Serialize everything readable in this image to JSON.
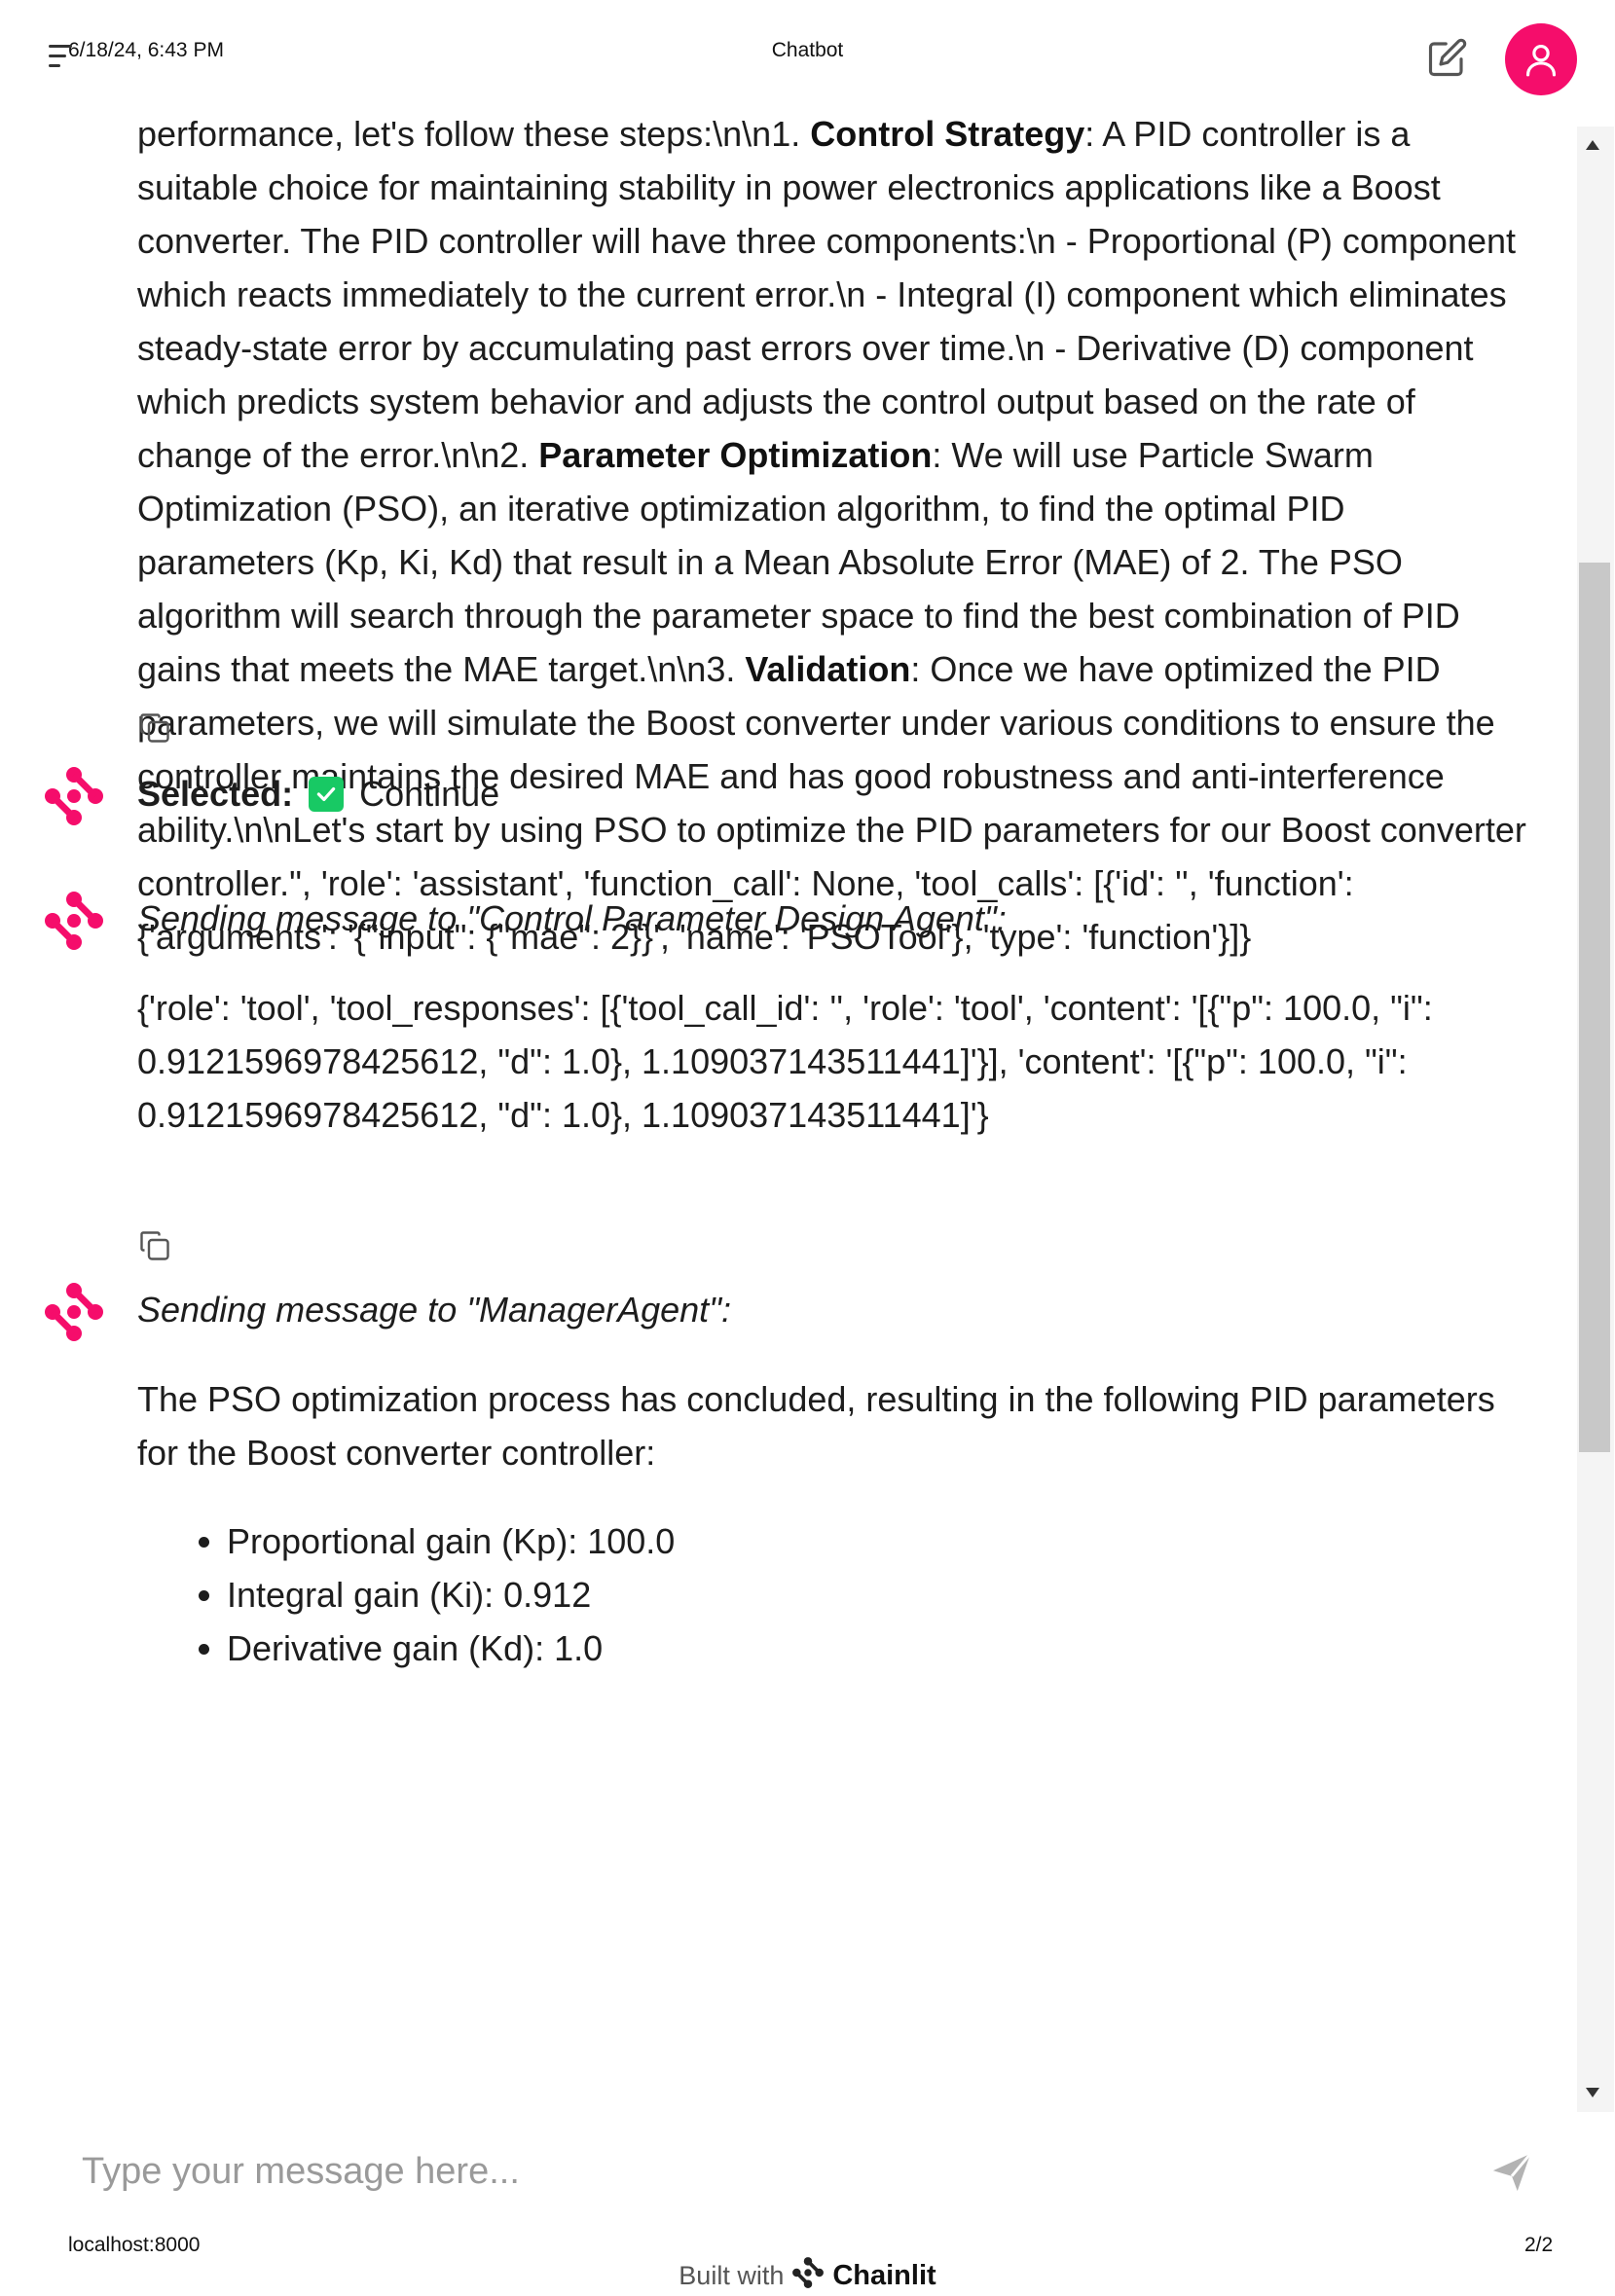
{
  "print_header": {
    "date": "6/18/24, 6:43 PM",
    "title": "Chatbot"
  },
  "print_footer": {
    "url": "localhost:8000",
    "page": "2/2"
  },
  "brand": {
    "accent": "#f50d6b",
    "check_color": "#18c964"
  },
  "icons": {
    "menu": "menu-icon",
    "edit": "edit-icon",
    "avatar": "user-avatar-icon",
    "copy": "copy-icon",
    "logo": "chainlit-logo-icon",
    "send": "send-icon"
  },
  "messages": {
    "m1": {
      "s1": "performance, let's follow these steps:\\n\\n1. ",
      "b1": "Control Strategy",
      "s2": ": A PID controller is a suitable choice for maintaining stability in power electronics applications like a Boost converter. The PID controller will have three components:\\n   - Proportional (P) component which reacts immediately to the current error.\\n   - Integral (I) component which eliminates steady-state error by accumulating past errors over time.\\n   - Derivative (D) component which predicts system behavior and adjusts the control output based on the rate of change of the error.\\n\\n2. ",
      "b2": "Parameter Optimization",
      "s3": ": We will use Particle Swarm Optimization (PSO), an iterative optimization algorithm, to find the optimal PID parameters (Kp, Ki, Kd) that result in a Mean Absolute Error (MAE) of 2. The PSO algorithm will search through the parameter space to find the best combination of PID gains that meets the MAE target.\\n\\n3. ",
      "b3": "Validation",
      "s4": ": Once we have optimized the PID parameters, we will simulate the Boost converter under various conditions to ensure the controller maintains the desired MAE and has good robustness and anti-interference ability.\\n\\nLet's start by using PSO to optimize the PID parameters for our Boost converter controller.\", 'role': 'assistant', 'function_call': None, 'tool_calls': [{'id': '', 'function': {'arguments': '{\"input\": {\"mae\": 2}}', 'name': 'PSOTool'}, 'type': 'function'}]}"
    },
    "m2": {
      "selected_label": "Selected:",
      "choice": "Continue"
    },
    "m3": {
      "heading": "Sending message to \"Control Parameter Design Agent\":",
      "body": "{'role': 'tool', 'tool_responses': [{'tool_call_id': '', 'role': 'tool', 'content': '[{\"p\": 100.0, \"i\": 0.9121596978425612, \"d\": 1.0}, 1.109037143511441]'}], 'content': '[{\"p\": 100.0, \"i\": 0.9121596978425612, \"d\": 1.0}, 1.109037143511441]'}"
    },
    "m4": {
      "heading": "Sending message to \"ManagerAgent\":",
      "body": "The PSO optimization process has concluded, resulting in the following PID parameters for the Boost converter controller:",
      "bullets": [
        "Proportional gain (Kp): 100.0",
        "Integral gain (Ki): 0.912",
        "Derivative gain (Kd): 1.0"
      ]
    }
  },
  "composer": {
    "placeholder": "Type your message here..."
  },
  "built_with": {
    "prefix": "Built with",
    "brand": "Chainlit"
  }
}
